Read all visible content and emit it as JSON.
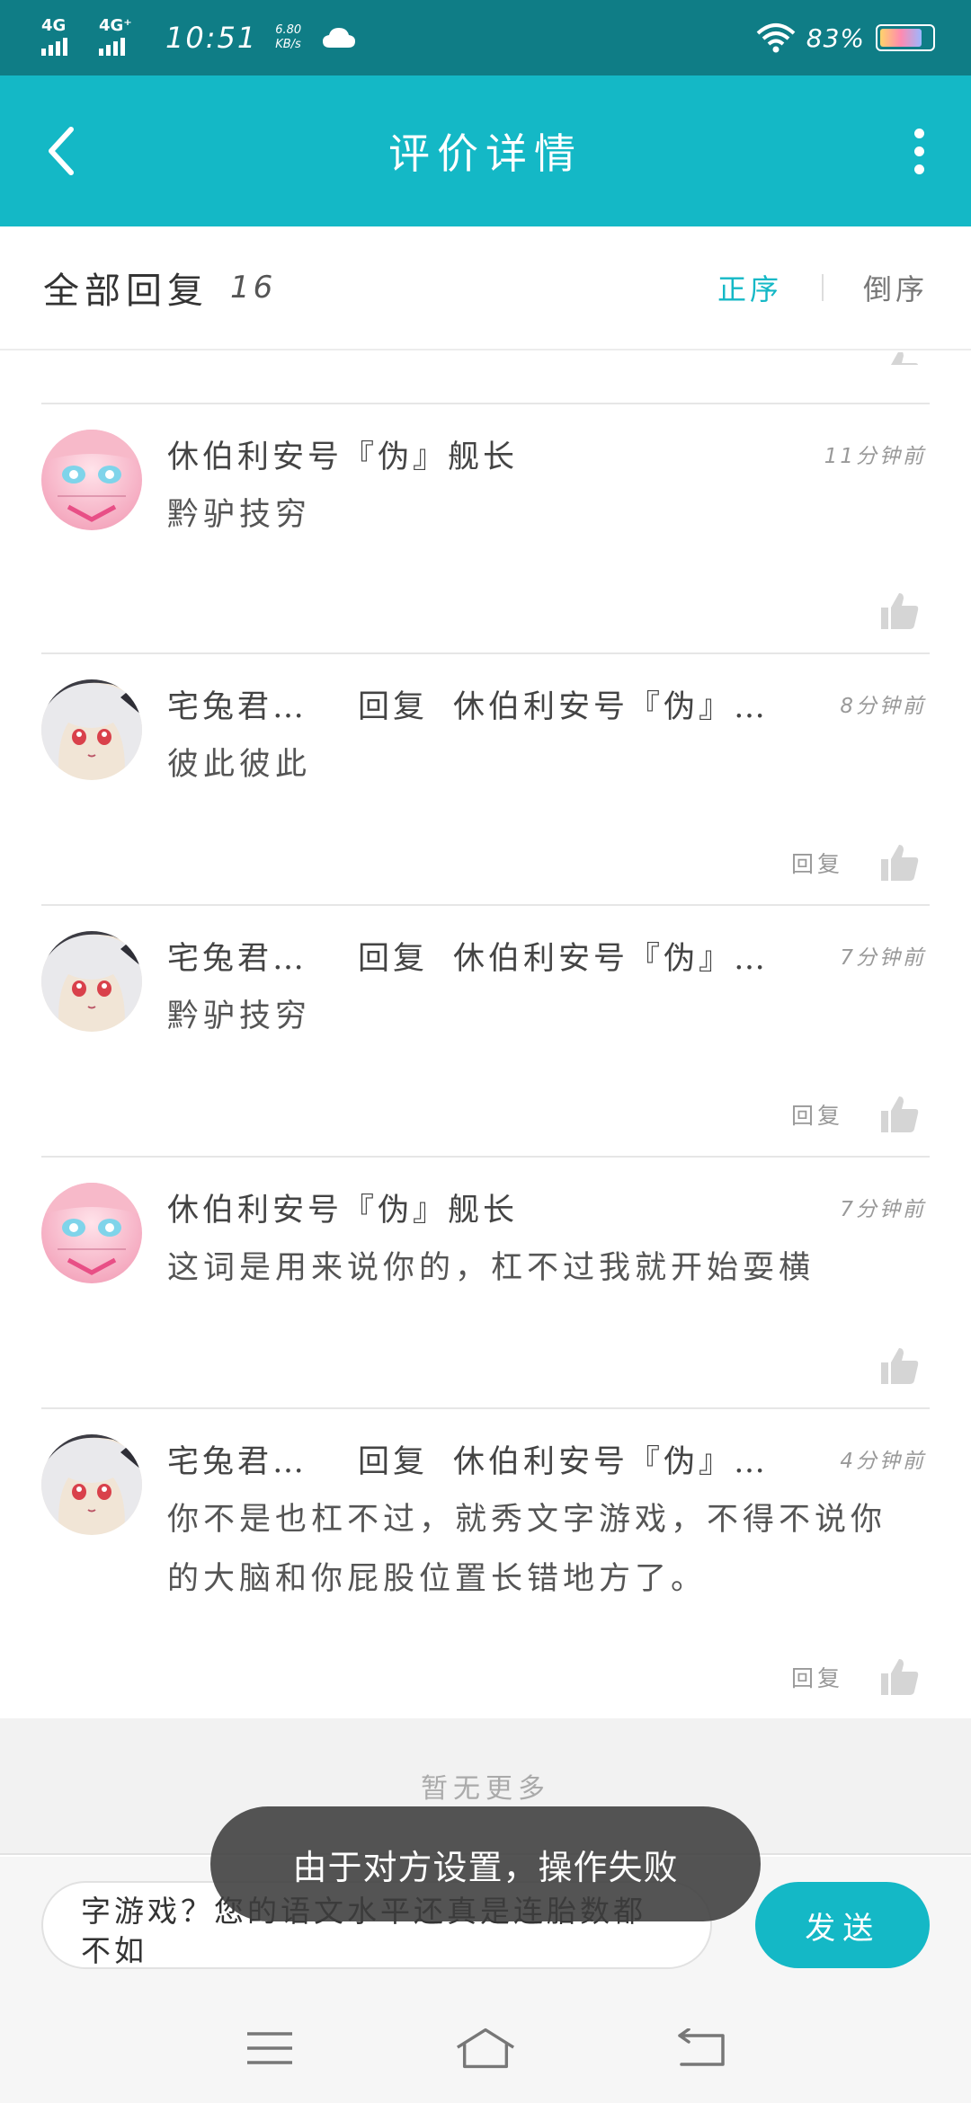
{
  "status_bar": {
    "network1": "4G",
    "network2": "4G⁺",
    "time": "10:51",
    "speed_value": "6.80",
    "speed_unit": "KB/s",
    "battery_percent": "83%"
  },
  "app_bar": {
    "title": "评价详情",
    "back_icon": "chevron-left-icon",
    "more_icon": "vertical-dots-icon"
  },
  "sub_header": {
    "title": "全部回复",
    "count": "16",
    "sort_asc": "正序",
    "sort_desc": "倒序",
    "active_sort": "正序"
  },
  "comments": [
    {
      "author": "休伯利安号『伪』舰长",
      "avatar": "pink-anime-avatar",
      "reply_label": "",
      "reply_to": "",
      "time": "11分钟前",
      "content": "黔驴技穷",
      "reply_button": ""
    },
    {
      "author": "宅兔君…",
      "avatar": "white-hair-anime-avatar",
      "reply_label": "回复",
      "reply_to": "休伯利安号『伪』…",
      "time": "8分钟前",
      "content": "彼此彼此",
      "reply_button": "回复"
    },
    {
      "author": "宅兔君…",
      "avatar": "white-hair-anime-avatar",
      "reply_label": "回复",
      "reply_to": "休伯利安号『伪』…",
      "time": "7分钟前",
      "content": "黔驴技穷",
      "reply_button": "回复"
    },
    {
      "author": "休伯利安号『伪』舰长",
      "avatar": "pink-anime-avatar",
      "reply_label": "",
      "reply_to": "",
      "time": "7分钟前",
      "content": "这词是用来说你的，杠不过我就开始耍横",
      "reply_button": ""
    },
    {
      "author": "宅兔君…",
      "avatar": "white-hair-anime-avatar",
      "reply_label": "回复",
      "reply_to": "休伯利安号『伪』…",
      "time": "4分钟前",
      "content": "你不是也杠不过，就秀文字游戏，不得不说你的大脑和你屁股位置长错地方了。",
      "reply_button": "回复"
    }
  ],
  "no_more_text": "暂无更多",
  "input": {
    "value": "字游戏？您的语文水平还真是连胎数都不如",
    "send_label": "发送"
  },
  "toast": {
    "message": "由于对方设置，操作失败"
  },
  "nav_bar": {
    "menu_icon": "menu-icon",
    "home_icon": "home-icon",
    "back_icon": "back-icon"
  },
  "colors": {
    "accent": "#14b8c6",
    "status_bar": "#0f7d86"
  }
}
